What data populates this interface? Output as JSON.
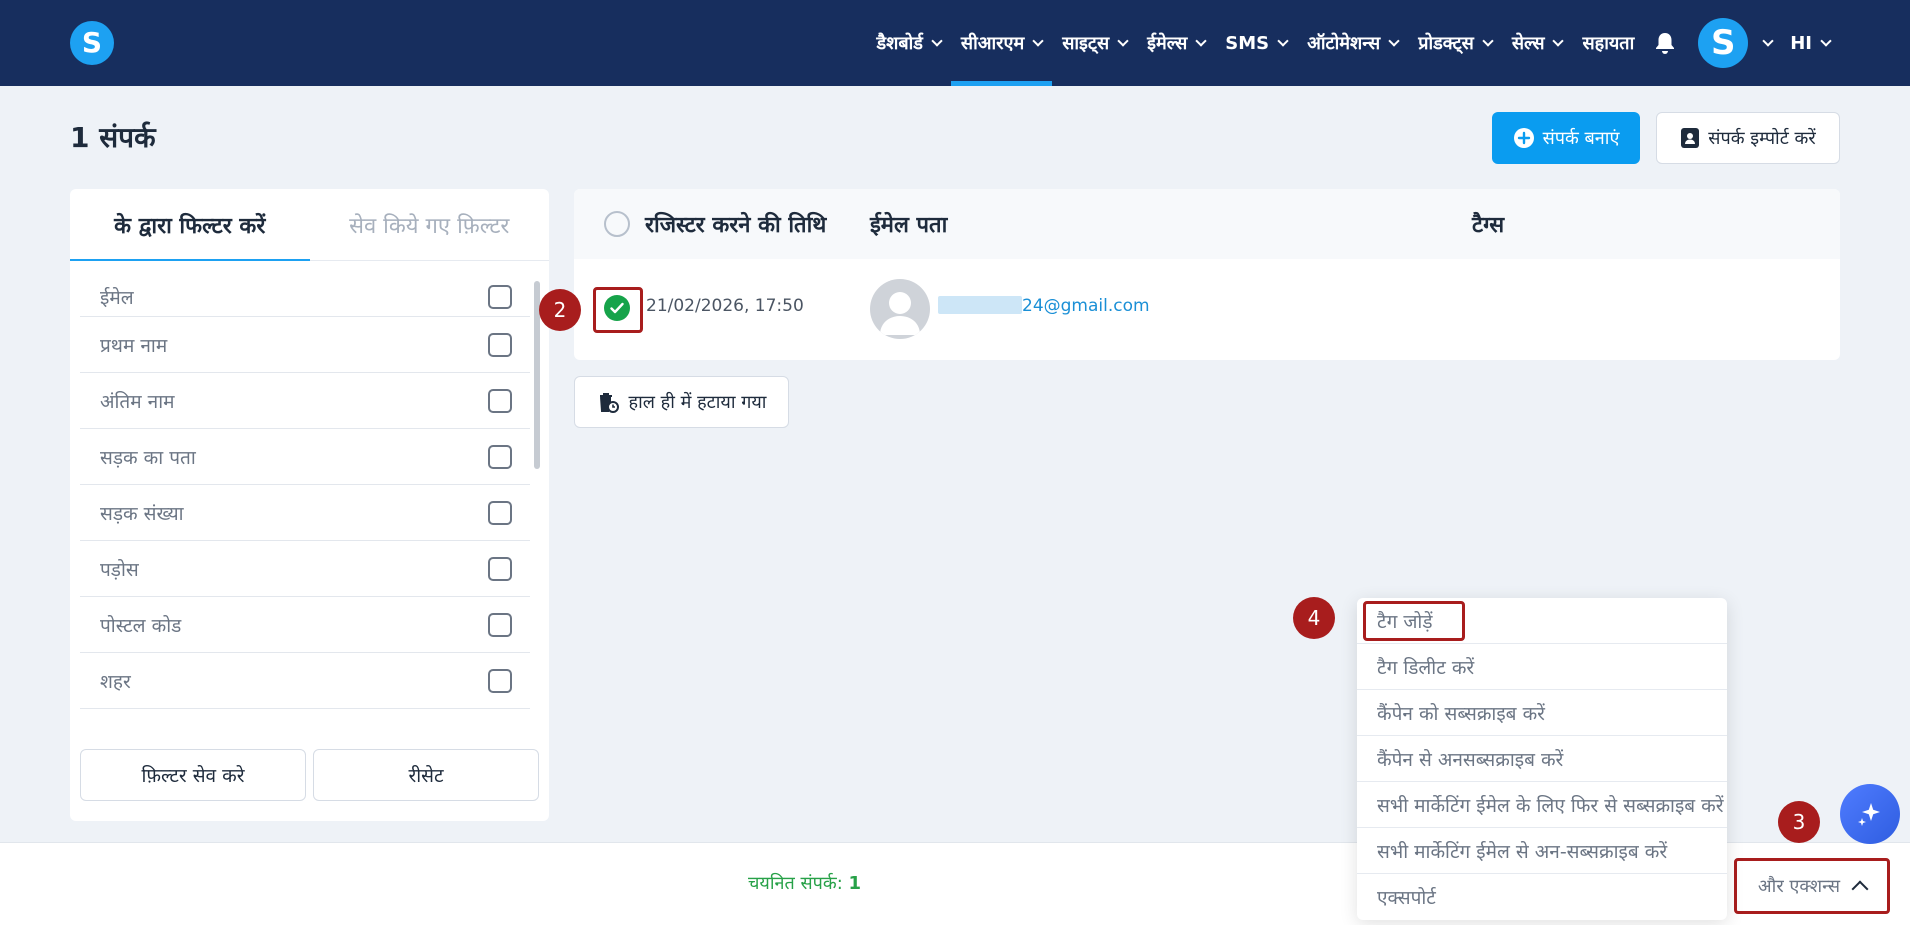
{
  "nav": {
    "logo": "S",
    "items": [
      {
        "label": "डैशबोर्ड",
        "active": false
      },
      {
        "label": "सीआरएम",
        "active": true
      },
      {
        "label": "साइट्स",
        "active": false
      },
      {
        "label": "ईमेल्स",
        "active": false
      },
      {
        "label": "SMS",
        "active": false
      },
      {
        "label": "ऑटोमेशन्स",
        "active": false
      },
      {
        "label": "प्रोडक्ट्स",
        "active": false
      },
      {
        "label": "सेल्स",
        "active": false
      }
    ],
    "help": "सहायता",
    "avatar": "S",
    "language": "HI",
    "active_color": "#1da1f2"
  },
  "header": {
    "title": "1 संपर्क",
    "create_contact": "संपर्क बनाएं",
    "import_contacts": "संपर्क इम्पोर्ट करें"
  },
  "filter_panel": {
    "tab_filter_by": "के द्वारा फिल्टर करें",
    "tab_saved": "सेव किये गए फ़िल्टर",
    "items": [
      {
        "label": "ईमेल"
      },
      {
        "label": "प्रथम नाम"
      },
      {
        "label": "अंतिम नाम"
      },
      {
        "label": "सड़क का पता"
      },
      {
        "label": "सड़क संख्या"
      },
      {
        "label": "पड़ोस"
      },
      {
        "label": "पोस्टल कोड"
      },
      {
        "label": "शहर"
      }
    ],
    "save_filter": "फ़िल्टर सेव करे",
    "reset": "रीसेट"
  },
  "table": {
    "columns": {
      "date": "रजिस्टर करने की तिथि",
      "email": "ईमेल पता",
      "tags": "टैग्स"
    },
    "rows": [
      {
        "date": "21/02/2026, 17:50",
        "email_suffix": "24@gmail.com",
        "selected": true
      }
    ]
  },
  "recently_deleted": "हाल ही में हटाया गया",
  "footer": {
    "selected_label": "चयनित संपर्क:",
    "selected_count": "1",
    "more_actions": "और एक्शन्स"
  },
  "dropdown": {
    "items": [
      {
        "label": "टैग जोड़ें"
      },
      {
        "label": "टैग डिलीट करें"
      },
      {
        "label": "कैंपेन को सब्सक्राइब करें"
      },
      {
        "label": "कैंपेन से अनसब्सक्राइब करें"
      },
      {
        "label": "सभी मार्केटिंग ईमेल के लिए फिर से सब्सक्राइब करें"
      },
      {
        "label": "सभी मार्केटिंग ईमेल से अन-सब्सक्राइब करें"
      },
      {
        "label": "एक्सपोर्ट"
      }
    ]
  },
  "markers": {
    "two": "2",
    "three": "3",
    "four": "4",
    "color": "#a81d1d"
  }
}
